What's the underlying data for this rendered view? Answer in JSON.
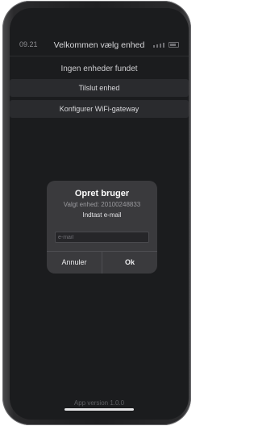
{
  "status_bar": {
    "time": "09.21"
  },
  "nav": {
    "title": "Velkommen vælg enhed"
  },
  "main": {
    "empty_message": "Ingen enheder fundet",
    "connect_label": "Tilslut enhed",
    "configure_label": "Konfigurer WiFi-gateway"
  },
  "dialog": {
    "title": "Opret bruger",
    "subtitle": "Valgt enhed: 20100248833",
    "message": "Indtast e-mail",
    "email_placeholder": "e-mail",
    "cancel_label": "Annuler",
    "ok_label": "Ok"
  },
  "footer": {
    "version": "App version 1.0.0"
  },
  "colors": {
    "background": "#1b1c1e",
    "row_button": "#2a2b2e",
    "dialog": "#3a3a3d"
  }
}
